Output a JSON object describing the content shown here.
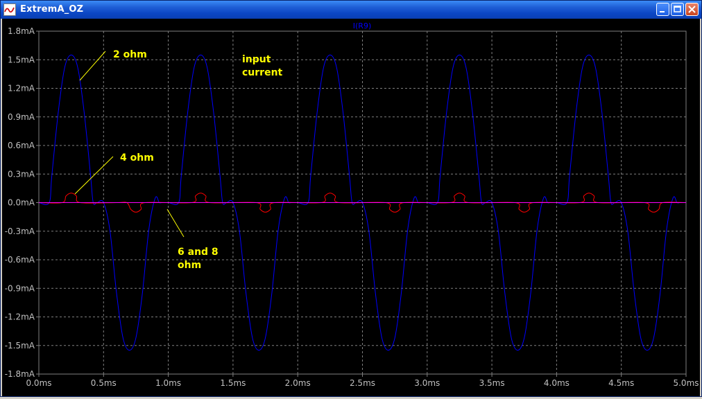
{
  "window": {
    "title": "ExtremA_OZ"
  },
  "chart_data": {
    "type": "line",
    "title": "I(R9)",
    "xlabel": "",
    "ylabel": "",
    "xlim": [
      0,
      5.0
    ],
    "ylim": [
      -1.8,
      1.8
    ],
    "grid": true,
    "x_ticks": [
      "0.0ms",
      "0.5ms",
      "1.0ms",
      "1.5ms",
      "2.0ms",
      "2.5ms",
      "3.0ms",
      "3.5ms",
      "4.0ms",
      "4.5ms",
      "5.0ms"
    ],
    "y_ticks": [
      "1.8mA",
      "1.5mA",
      "1.2mA",
      "0.9mA",
      "0.6mA",
      "0.3mA",
      "0.0mA",
      "-0.3mA",
      "-0.6mA",
      "-0.9mA",
      "-1.2mA",
      "-1.5mA",
      "-1.8mA"
    ],
    "series": [
      {
        "color": "#0000ff",
        "x": [
          0.0,
          0.08,
          0.1,
          0.15,
          0.2,
          0.25,
          0.3,
          0.35,
          0.4,
          0.42,
          0.45,
          0.5,
          0.55,
          0.6,
          0.65,
          0.7,
          0.75,
          0.8,
          0.85,
          0.9,
          0.93,
          0.95,
          1.0,
          1.08,
          1.1,
          1.15,
          1.2,
          1.25,
          1.3,
          1.35,
          1.4,
          1.42,
          1.45,
          1.5,
          1.55,
          1.6,
          1.65,
          1.7,
          1.75,
          1.8,
          1.85,
          1.9,
          1.93,
          1.95,
          2.0,
          2.08,
          2.1,
          2.15,
          2.2,
          2.25,
          2.3,
          2.35,
          2.4,
          2.42,
          2.45,
          2.5,
          2.55,
          2.6,
          2.65,
          2.7,
          2.75,
          2.8,
          2.85,
          2.9,
          2.93,
          2.95,
          3.0,
          3.08,
          3.1,
          3.15,
          3.2,
          3.25,
          3.3,
          3.35,
          3.4,
          3.42,
          3.45,
          3.5,
          3.55,
          3.6,
          3.65,
          3.7,
          3.75,
          3.8,
          3.85,
          3.9,
          3.93,
          3.95,
          4.0,
          4.08,
          4.1,
          4.15,
          4.2,
          4.25,
          4.3,
          4.35,
          4.4,
          4.42,
          4.45,
          4.5,
          4.55,
          4.6,
          4.65,
          4.7,
          4.75,
          4.8,
          4.85,
          4.9,
          4.93,
          4.95
        ],
        "y": [
          0.0,
          0.0,
          0.28,
          0.95,
          1.42,
          1.55,
          1.42,
          0.95,
          0.28,
          0.0,
          0.0,
          0.0,
          -0.3,
          -0.95,
          -1.42,
          -1.55,
          -1.42,
          -0.95,
          -0.28,
          0.05,
          0.0,
          0.0,
          0.0,
          0.0,
          0.28,
          0.95,
          1.42,
          1.55,
          1.42,
          0.95,
          0.28,
          0.0,
          0.0,
          0.0,
          -0.3,
          -0.95,
          -1.42,
          -1.55,
          -1.42,
          -0.95,
          -0.28,
          0.05,
          0.0,
          0.0,
          0.0,
          0.0,
          0.28,
          0.95,
          1.42,
          1.55,
          1.42,
          0.95,
          0.28,
          0.0,
          0.0,
          0.0,
          -0.3,
          -0.95,
          -1.42,
          -1.55,
          -1.42,
          -0.95,
          -0.28,
          0.05,
          0.0,
          0.0,
          0.0,
          0.0,
          0.28,
          0.95,
          1.42,
          1.55,
          1.42,
          0.95,
          0.28,
          0.0,
          0.0,
          0.0,
          -0.3,
          -0.95,
          -1.42,
          -1.55,
          -1.42,
          -0.95,
          -0.28,
          0.05,
          0.0,
          0.0,
          0.0,
          0.0,
          0.28,
          0.95,
          1.42,
          1.55,
          1.42,
          0.95,
          0.28,
          0.0,
          0.0,
          0.0,
          -0.3,
          -0.95,
          -1.42,
          -1.55,
          -1.42,
          -0.95,
          -0.28,
          0.05,
          0.0,
          0.0
        ]
      },
      {
        "color": "#ff0000",
        "x": [
          0.0,
          0.18,
          0.21,
          0.25,
          0.29,
          0.32,
          0.6,
          0.68,
          0.71,
          0.75,
          0.79,
          0.82,
          1.18,
          1.21,
          1.25,
          1.29,
          1.32,
          1.68,
          1.71,
          1.75,
          1.79,
          1.82,
          2.18,
          2.21,
          2.25,
          2.29,
          2.32,
          2.68,
          2.71,
          2.75,
          2.79,
          2.82,
          3.18,
          3.21,
          3.25,
          3.29,
          3.32,
          3.68,
          3.71,
          3.75,
          3.79,
          3.82,
          4.18,
          4.21,
          4.25,
          4.29,
          4.32,
          4.68,
          4.71,
          4.75,
          4.79,
          4.82,
          5.0
        ],
        "y": [
          0.0,
          0.0,
          0.07,
          0.1,
          0.07,
          0.0,
          0.0,
          0.0,
          -0.07,
          -0.1,
          -0.07,
          0.0,
          0.0,
          0.07,
          0.1,
          0.07,
          0.0,
          0.0,
          -0.07,
          -0.1,
          -0.07,
          0.0,
          0.0,
          0.07,
          0.1,
          0.07,
          0.0,
          0.0,
          -0.07,
          -0.1,
          -0.07,
          0.0,
          0.0,
          0.07,
          0.1,
          0.07,
          0.0,
          0.0,
          -0.07,
          -0.1,
          -0.07,
          0.0,
          0.0,
          0.07,
          0.1,
          0.07,
          0.0,
          0.0,
          -0.07,
          -0.1,
          -0.07,
          0.0,
          0.0
        ]
      },
      {
        "color": "#ff00ff",
        "x": [
          0.0,
          5.0
        ],
        "y": [
          0.0,
          0.0
        ]
      }
    ],
    "annotations": [
      {
        "id": "ann-2ohm",
        "lines": [
          "2 ohm"
        ],
        "color": "#ffff00"
      },
      {
        "id": "ann-input",
        "lines": [
          "input",
          "current"
        ],
        "color": "#ffff00"
      },
      {
        "id": "ann-4ohm",
        "lines": [
          "4 ohm"
        ],
        "color": "#ffff00"
      },
      {
        "id": "ann-68ohm",
        "lines": [
          "6 and 8",
          "ohm"
        ],
        "color": "#ffff00"
      }
    ]
  }
}
